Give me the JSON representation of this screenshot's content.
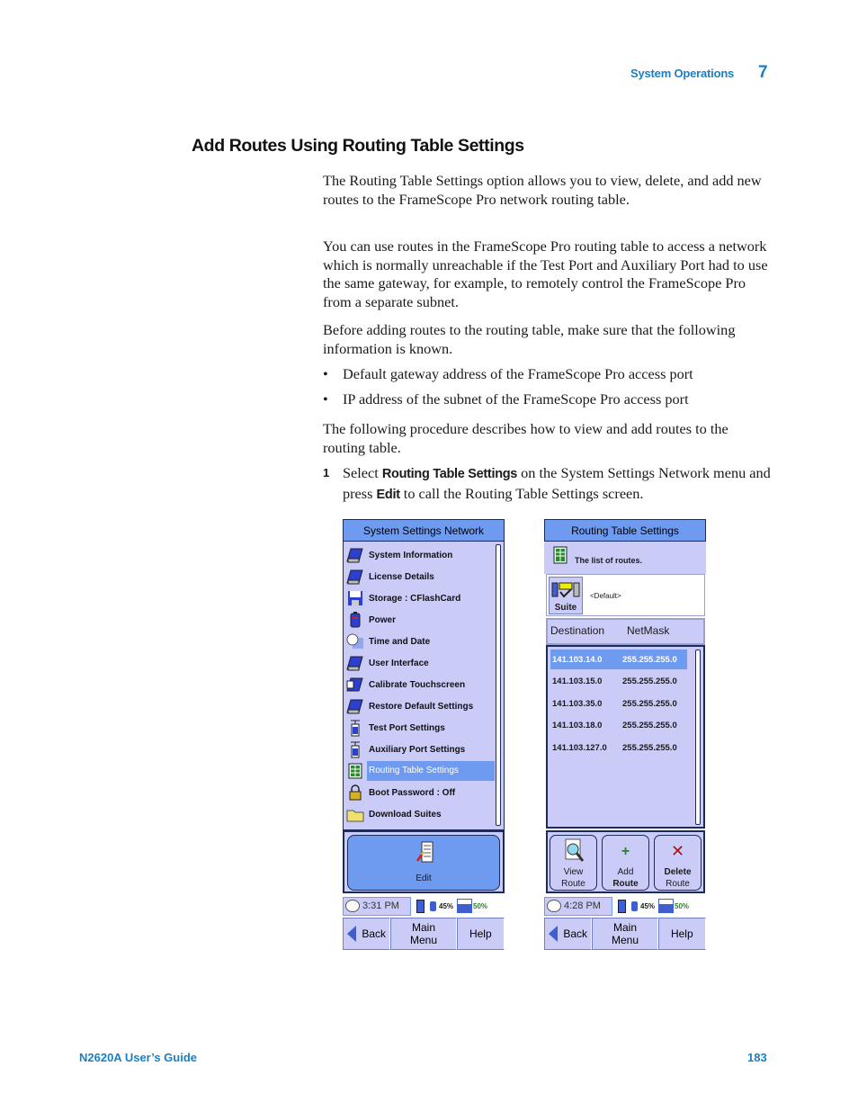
{
  "page_header": {
    "section": "System Operations",
    "chapter": "7"
  },
  "title": "Add Routes Using Routing Table Settings",
  "paragraphs": [
    "The Routing Table Settings option allows you to view, delete, and add new routes to the FrameScope Pro network routing table.",
    "You can use routes in the FrameScope Pro routing table to access a network which is normally unreachable if the Test Port and Auxiliary Port had to use the same gateway, for example, to remotely control the FrameScope Pro from a separate subnet.",
    "Before adding routes to the routing table, make sure that the following information is known.",
    "The following procedure describes how to view and add routes to the routing table."
  ],
  "bullets": [
    "Default gateway address of the FrameScope Pro access port",
    "IP address of the subnet of the FrameScope Pro access port"
  ],
  "step": {
    "number": "1",
    "t1": "Select ",
    "k1": "Routing Table Settings",
    "t2": " on the System Settings Network menu and press ",
    "k2": "Edit",
    "t3": " to call the Routing Table Settings screen."
  },
  "screen1": {
    "title": "System Settings Network",
    "items": [
      {
        "label": "System Information",
        "icon": "pda-icon"
      },
      {
        "label": "License Details",
        "icon": "pda-icon"
      },
      {
        "label": "Storage : CFlashCard",
        "icon": "cf-disk-icon"
      },
      {
        "label": "Power",
        "icon": "battery-icon"
      },
      {
        "label": "Time and Date",
        "icon": "clock-calendar-icon"
      },
      {
        "label": "User Interface",
        "icon": "pda-icon"
      },
      {
        "label": "Calibrate Touchscreen",
        "icon": "touch-pda-icon"
      },
      {
        "label": "Restore Default Settings",
        "icon": "pda-icon"
      },
      {
        "label": "Test Port Settings",
        "icon": "port-icon"
      },
      {
        "label": "Auxiliary Port Settings",
        "icon": "port-icon"
      },
      {
        "label": "Routing Table Settings",
        "icon": "table-icon",
        "selected": true
      },
      {
        "label": "Boot Password : Off",
        "icon": "padlock-icon"
      },
      {
        "label": "Download Suites",
        "icon": "folder-icon"
      }
    ],
    "action_label": "Edit",
    "time": "3:31 PM",
    "battery_pct": "45%",
    "storage_pct": "50%",
    "nav": {
      "back": "Back",
      "main": "Main Menu",
      "help": "Help"
    }
  },
  "screen2": {
    "title": "Routing Table Settings",
    "description": "The list of routes.",
    "suite_label": "Suite",
    "suite_value": "<Default>",
    "columns": {
      "destination": "Destination",
      "netmask": "NetMask"
    },
    "routes": [
      {
        "destination": "141.103.14.0",
        "netmask": "255.255.255.0",
        "selected": true
      },
      {
        "destination": "141.103.15.0",
        "netmask": "255.255.255.0"
      },
      {
        "destination": "141.103.35.0",
        "netmask": "255.255.255.0"
      },
      {
        "destination": "141.103.18.0",
        "netmask": "255.255.255.0"
      },
      {
        "destination": "141.103.127.0",
        "netmask": "255.255.255.0"
      }
    ],
    "actions": [
      {
        "line1": "View",
        "line2": "Route"
      },
      {
        "line1": "Add",
        "line2": "Route"
      },
      {
        "line1": "Delete",
        "line2": "Route"
      }
    ],
    "time": "4:28 PM",
    "battery_pct": "45%",
    "storage_pct": "50%",
    "nav": {
      "back": "Back",
      "main": "Main Menu",
      "help": "Help"
    }
  },
  "footer": {
    "guide": "N2620A User’s Guide",
    "page": "183"
  }
}
